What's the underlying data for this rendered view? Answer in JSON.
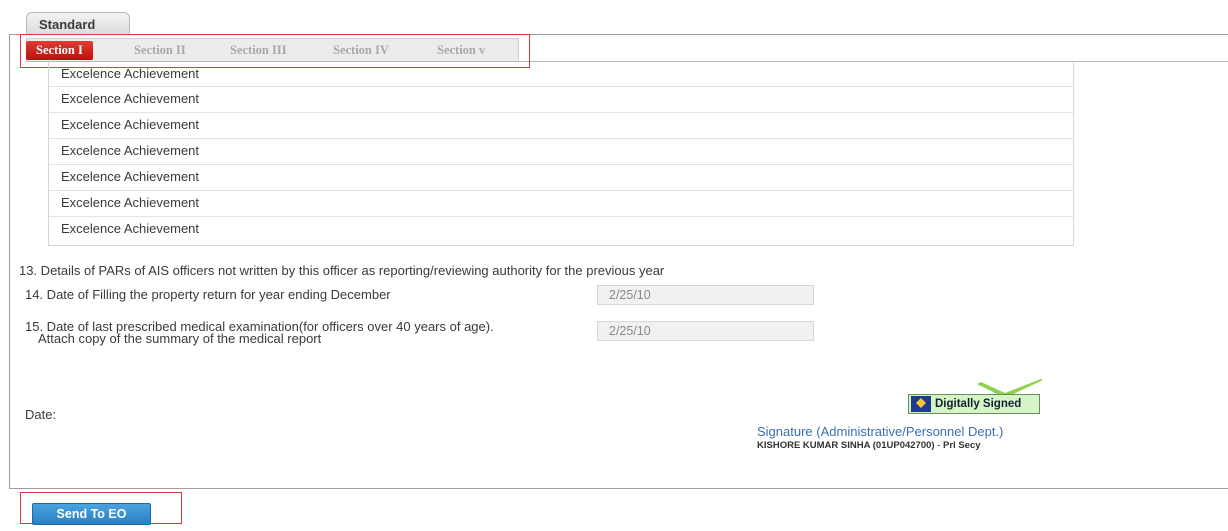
{
  "outer_tab": {
    "label": "Standard"
  },
  "section_tabs": [
    {
      "label": "Section I",
      "active": true
    },
    {
      "label": "Section II",
      "active": false
    },
    {
      "label": "Section III",
      "active": false
    },
    {
      "label": "Section IV",
      "active": false
    },
    {
      "label": "Section v",
      "active": false
    }
  ],
  "achievements": [
    "Excelence Achievement",
    "Excelence Achievement",
    "Excelence Achievement",
    "Excelence Achievement",
    "Excelence Achievement",
    "Excelence Achievement",
    "Excelence Achievement"
  ],
  "items": {
    "item13": "13. Details of PARs of AIS officers not written by this officer as reporting/reviewing authority for the previous year",
    "item14_label": "14. Date of Filling the property return for year ending December",
    "item14_value": "2/25/10",
    "item15_label_line1": "15. Date of last prescribed medical examination(for officers over 40 years of age).",
    "item15_label_line2": "Attach copy of the summary of the medical report",
    "item15_value": "2/25/10"
  },
  "date_label": "Date:",
  "signature": {
    "badge": "Digitally Signed",
    "title": "Signature (Administrative/Personnel Dept.)",
    "name": "KISHORE KUMAR SINHA (01UP042700)",
    "dash": "-",
    "role": "Prl Secy"
  },
  "send_button": "Send To EO",
  "colors": {
    "accent_red": "#c61a12",
    "button_blue": "#2a80c4",
    "signed_green": "#d6f5c7"
  }
}
